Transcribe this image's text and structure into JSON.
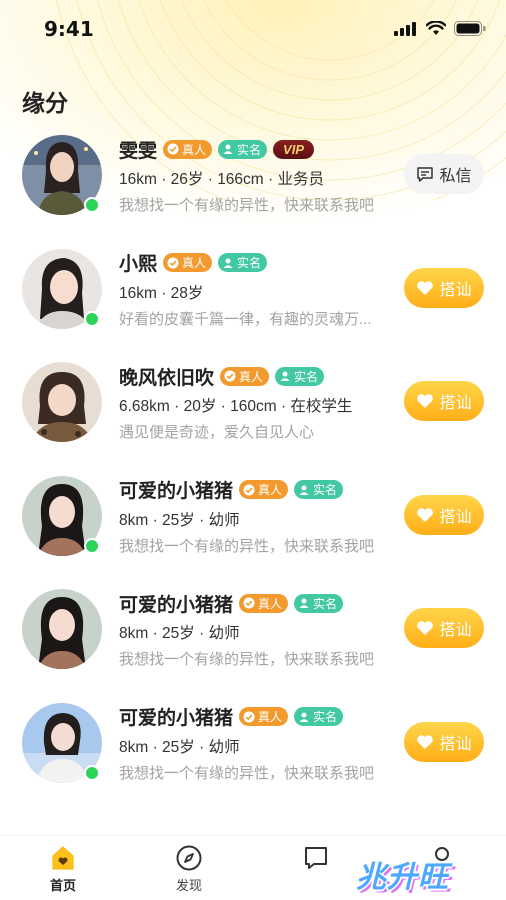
{
  "status_bar": {
    "time": "9:41"
  },
  "page": {
    "title": "缘分"
  },
  "badges": {
    "real": "真人",
    "verified_name": "实名",
    "vip": "VIP"
  },
  "buttons": {
    "message": "私信",
    "greet": "搭讪"
  },
  "users": [
    {
      "name": "雯雯",
      "info": "16km · 26岁 · 166cm · 业务员",
      "bio": "我想找一个有缘的异性，快来联系我吧",
      "online": true,
      "vip": true,
      "action": "message"
    },
    {
      "name": "小熙",
      "info": "16km · 28岁",
      "bio": "好看的皮囊千篇一律，有趣的灵魂万...",
      "online": true,
      "vip": false,
      "action": "greet"
    },
    {
      "name": "晚风依旧吹",
      "info": "6.68km · 20岁 · 160cm · 在校学生",
      "bio": "遇见便是奇迹，爱久自见人心",
      "online": false,
      "vip": false,
      "action": "greet"
    },
    {
      "name": "可爱的小猪猪",
      "info": "8km · 25岁 · 幼师",
      "bio": "我想找一个有缘的异性，快来联系我吧",
      "online": true,
      "vip": false,
      "action": "greet"
    },
    {
      "name": "可爱的小猪猪",
      "info": "8km · 25岁 · 幼师",
      "bio": "我想找一个有缘的异性，快来联系我吧",
      "online": false,
      "vip": false,
      "action": "greet"
    },
    {
      "name": "可爱的小猪猪",
      "info": "8km · 25岁 · 幼师",
      "bio": "我想找一个有缘的异性，快来联系我吧",
      "online": true,
      "vip": false,
      "action": "greet"
    }
  ],
  "tab_bar": {
    "items": [
      {
        "label": "首页",
        "icon": "home-icon",
        "active": true
      },
      {
        "label": "发现",
        "icon": "compass-icon",
        "active": false
      },
      {
        "label": "",
        "icon": "message-icon",
        "active": false
      },
      {
        "label": "",
        "icon": "profile-icon",
        "active": false
      }
    ]
  },
  "watermark": {
    "text": "兆升旺"
  },
  "colors": {
    "accent": "#ffb21e",
    "online": "#2ed35a",
    "badge_real": "#f29a2e",
    "badge_name": "#42c9a3"
  }
}
